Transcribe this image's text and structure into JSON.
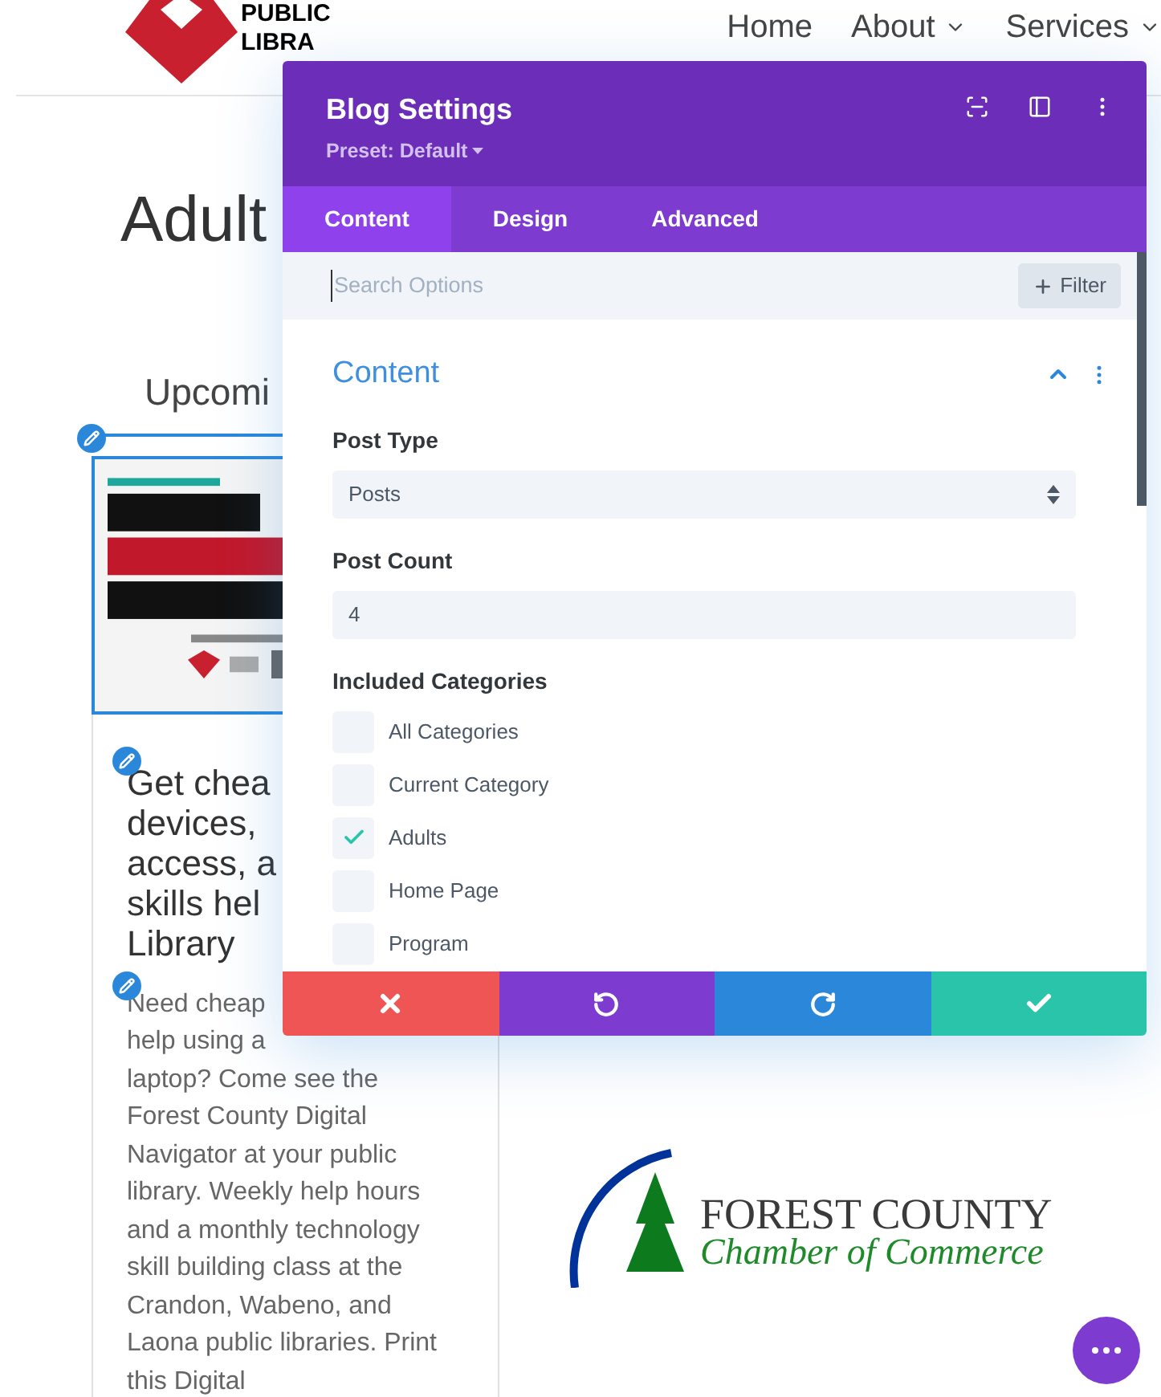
{
  "site_header": {
    "logo_lines": [
      "PUBLIC",
      "LIBRA"
    ],
    "nav": [
      {
        "label": "Home",
        "has_menu": false
      },
      {
        "label": "About",
        "has_menu": true
      },
      {
        "label": "Services",
        "has_menu": true
      }
    ]
  },
  "page": {
    "title": "Adult",
    "tab_label": "Upcomi",
    "post": {
      "title_lines": [
        "Get chea",
        "devices,",
        "access, a",
        "skills hel",
        "Library"
      ],
      "excerpt_lines": [
        "Need cheap",
        "help using a",
        "laptop? Come see the",
        "Forest County Digital",
        "Navigator at your public",
        "library. Weekly help hours",
        "and a monthly technology",
        "skill building class at the",
        "Crandon, Wabeno, and",
        "Laona public libraries. Print",
        "this Digital"
      ]
    },
    "sponsor_logo": {
      "line_1": "FOREST COUNTY",
      "line_2": "Chamber of Commerce"
    }
  },
  "settings_modal": {
    "title": "Blog Settings",
    "preset": "Preset: Default",
    "tabs": [
      {
        "label": "Content",
        "selected": true
      },
      {
        "label": "Design",
        "selected": false
      },
      {
        "label": "Advanced",
        "selected": false
      }
    ],
    "search": {
      "placeholder": "Search Options"
    },
    "filter_button": "Filter",
    "section": {
      "title": "Content",
      "expanded": true,
      "fields": [
        {
          "kind": "select",
          "label": "Post Type",
          "value": "Posts"
        },
        {
          "kind": "input",
          "label": "Post Count",
          "value": "4"
        },
        {
          "kind": "checkboxes",
          "label": "Included Categories",
          "options": [
            {
              "label": "All Categories",
              "checked": false
            },
            {
              "label": "Current Category",
              "checked": false
            },
            {
              "label": "Adults",
              "checked": true
            },
            {
              "label": "Home Page",
              "checked": false
            },
            {
              "label": "Program",
              "checked": false
            }
          ]
        }
      ]
    },
    "actions": [
      {
        "kind": "cancel",
        "color": "#ef5555"
      },
      {
        "kind": "undo",
        "color": "#7e3bd0"
      },
      {
        "kind": "redo",
        "color": "#2b87da"
      },
      {
        "kind": "save",
        "color": "#29c4a9"
      }
    ]
  }
}
